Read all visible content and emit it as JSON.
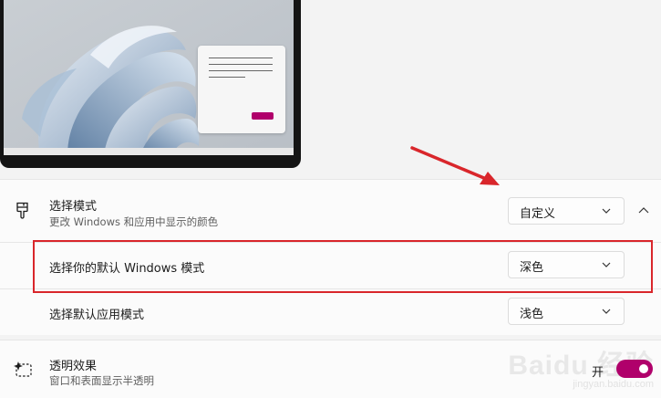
{
  "colors": {
    "accent": "#b0006b",
    "annotation_red": "#d9262b",
    "page_bg": "#f3f3f3",
    "card_bg": "#fbfbfb"
  },
  "preview": {
    "wallpaper": "windows-11-bloom",
    "window_accent_button": "accent-pill"
  },
  "mode_setting": {
    "icon": "paintbrush-icon",
    "title": "选择模式",
    "subtitle": "更改 Windows 和应用中显示的颜色",
    "dropdown_value": "自定义",
    "expanded": true
  },
  "windows_mode": {
    "title": "选择你的默认 Windows 模式",
    "dropdown_value": "深色"
  },
  "app_mode": {
    "title": "选择默认应用模式",
    "dropdown_value": "浅色"
  },
  "transparency": {
    "icon": "sparkle-frame-icon",
    "title": "透明效果",
    "subtitle": "窗口和表面显示半透明",
    "toggle_state": "开",
    "toggle_on": true
  },
  "watermark": {
    "main": "Baidu 经验",
    "url": "jingyan.baidu.com"
  }
}
